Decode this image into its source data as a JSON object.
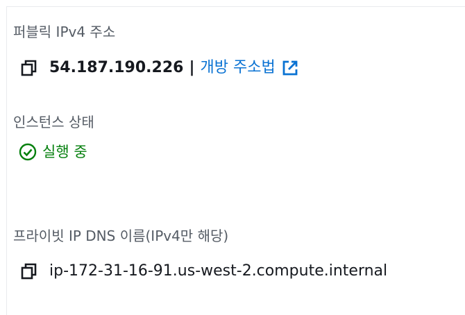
{
  "public_ipv4": {
    "label": "퍼블릭 IPv4 주소",
    "value": "54.187.190.226",
    "separator": "|",
    "open_link": "개방 주소법"
  },
  "instance_state": {
    "label": "인스턴스 상태",
    "status": "실행 중",
    "status_color": "#037f0c"
  },
  "private_dns": {
    "label": "프라이빗 IP DNS 이름(IPv4만 해당)",
    "value": "ip-172-31-16-91.us-west-2.compute.internal"
  },
  "icons": {
    "copy": "copy-icon",
    "external": "external-link-icon",
    "status": "check-circle-icon"
  },
  "colors": {
    "link": "#0972d3",
    "label": "#545b64",
    "text": "#16191f",
    "success": "#037f0c"
  }
}
